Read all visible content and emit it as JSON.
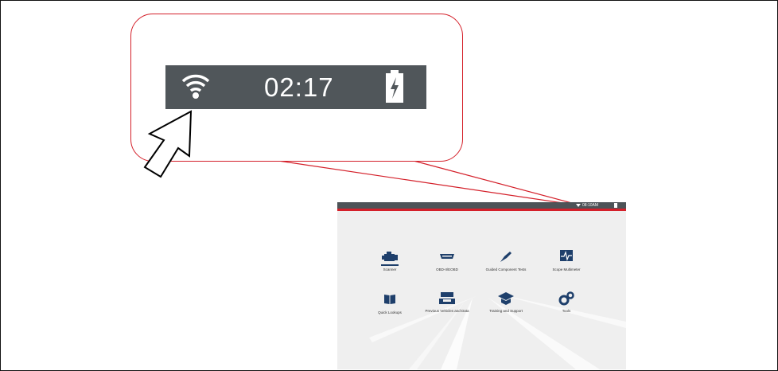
{
  "callout": {
    "time": "02:17",
    "icons": [
      "wifi-icon",
      "battery-charging-icon",
      "pointer-arrow-icon"
    ],
    "accent_color": "#d4202a",
    "status_bar_color": "#50565a"
  },
  "tablet": {
    "status_time": "08:10AM",
    "tiles": [
      {
        "label": "Scanner",
        "icon": "engine-icon"
      },
      {
        "label": "OBD-II/EOBD",
        "icon": "obd-connector-icon"
      },
      {
        "label": "Guided Component Tests",
        "icon": "probe-icon"
      },
      {
        "label": "Scope Multimeter",
        "icon": "waveform-icon"
      },
      {
        "label": "Quick Lookups",
        "icon": "book-icon"
      },
      {
        "label": "Previous Vehicles and Data",
        "icon": "vehicles-icon"
      },
      {
        "label": "Training and Support",
        "icon": "graduation-cap-icon"
      },
      {
        "label": "Tools",
        "icon": "gears-icon"
      }
    ],
    "icon_color": "#1e3f6b"
  }
}
